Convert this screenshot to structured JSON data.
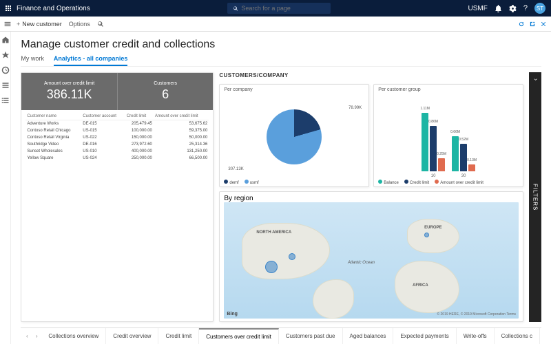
{
  "topbar": {
    "app_title": "Finance and Operations",
    "search_placeholder": "Search for a page",
    "company": "USMF",
    "avatar_initials": "ST"
  },
  "actionbar": {
    "new_customer": "New customer",
    "options": "Options"
  },
  "page": {
    "title": "Manage customer credit and collections",
    "tabs": [
      "My work",
      "Analytics - all companies"
    ],
    "active_tab": 1
  },
  "kpi": {
    "amount_label": "Amount over credit limit",
    "amount_value": "386.11K",
    "customers_label": "Customers",
    "customers_value": "6",
    "columns": [
      "Customer name",
      "Customer account",
      "Credit limit",
      "Amount over credit limit"
    ],
    "rows": [
      [
        "Adventure Works",
        "DE-015",
        "205,479.45",
        "53,675.62"
      ],
      [
        "Contoso Retail Chicago",
        "US-015",
        "100,000.00",
        "59,375.00"
      ],
      [
        "Contoso Retail Virginia",
        "US-022",
        "150,000.00",
        "50,000.00"
      ],
      [
        "Southridge Video",
        "DE-016",
        "273,972.60",
        "25,314.36"
      ],
      [
        "Sunset Wholesales",
        "US-010",
        "400,000.00",
        "131,250.00"
      ],
      [
        "Yellow Square",
        "US-024",
        "250,000.00",
        "66,500.00"
      ]
    ]
  },
  "charts_header": "CUSTOMERS/COMPANY",
  "pie": {
    "title": "Per company",
    "legend": [
      "demf",
      "usmf"
    ],
    "colors": {
      "demf": "#1c3d6b",
      "usmf": "#5a9fdc"
    },
    "label_demf": "78.99K",
    "label_usmf": "307.13K"
  },
  "bars": {
    "title": "Per customer group",
    "legend": [
      "Balance",
      "Credit limit",
      "Amount over credit limit"
    ],
    "colors": {
      "balance": "#1db5a4",
      "credit": "#1c3d6b",
      "over": "#e06b4f"
    },
    "categories": [
      "10",
      "30"
    ],
    "series": {
      "balance": [
        "1.11M",
        "0.66M"
      ],
      "credit": [
        "0.86M",
        "0.52M"
      ],
      "over": [
        "0.25M",
        "0.13M"
      ]
    }
  },
  "map": {
    "title": "By region",
    "labels": {
      "na": "NORTH AMERICA",
      "eu": "EUROPE",
      "af": "AFRICA",
      "ocean": "Atlantic Ocean"
    },
    "bing": "Bing",
    "credits": "© 2019 HERE, © 2019 Microsoft Corporation Terms"
  },
  "filters_label": "FILTERS",
  "bottom_tabs": [
    "Collections overview",
    "Credit overview",
    "Credit limit",
    "Customers over credit limit",
    "Customers past due",
    "Aged balances",
    "Expected payments",
    "Write-offs",
    "Collections c"
  ],
  "bottom_active": 3,
  "chart_data": [
    {
      "type": "pie",
      "title": "Per company",
      "series": [
        {
          "name": "demf",
          "value": 78.99
        },
        {
          "name": "usmf",
          "value": 307.13
        }
      ],
      "unit": "K"
    },
    {
      "type": "bar",
      "title": "Per customer group",
      "categories": [
        "10",
        "30"
      ],
      "series": [
        {
          "name": "Balance",
          "values": [
            1.11,
            0.66
          ]
        },
        {
          "name": "Credit limit",
          "values": [
            0.86,
            0.52
          ]
        },
        {
          "name": "Amount over credit limit",
          "values": [
            0.25,
            0.13
          ]
        }
      ],
      "unit": "M",
      "ylim": [
        0,
        1.2
      ]
    }
  ]
}
